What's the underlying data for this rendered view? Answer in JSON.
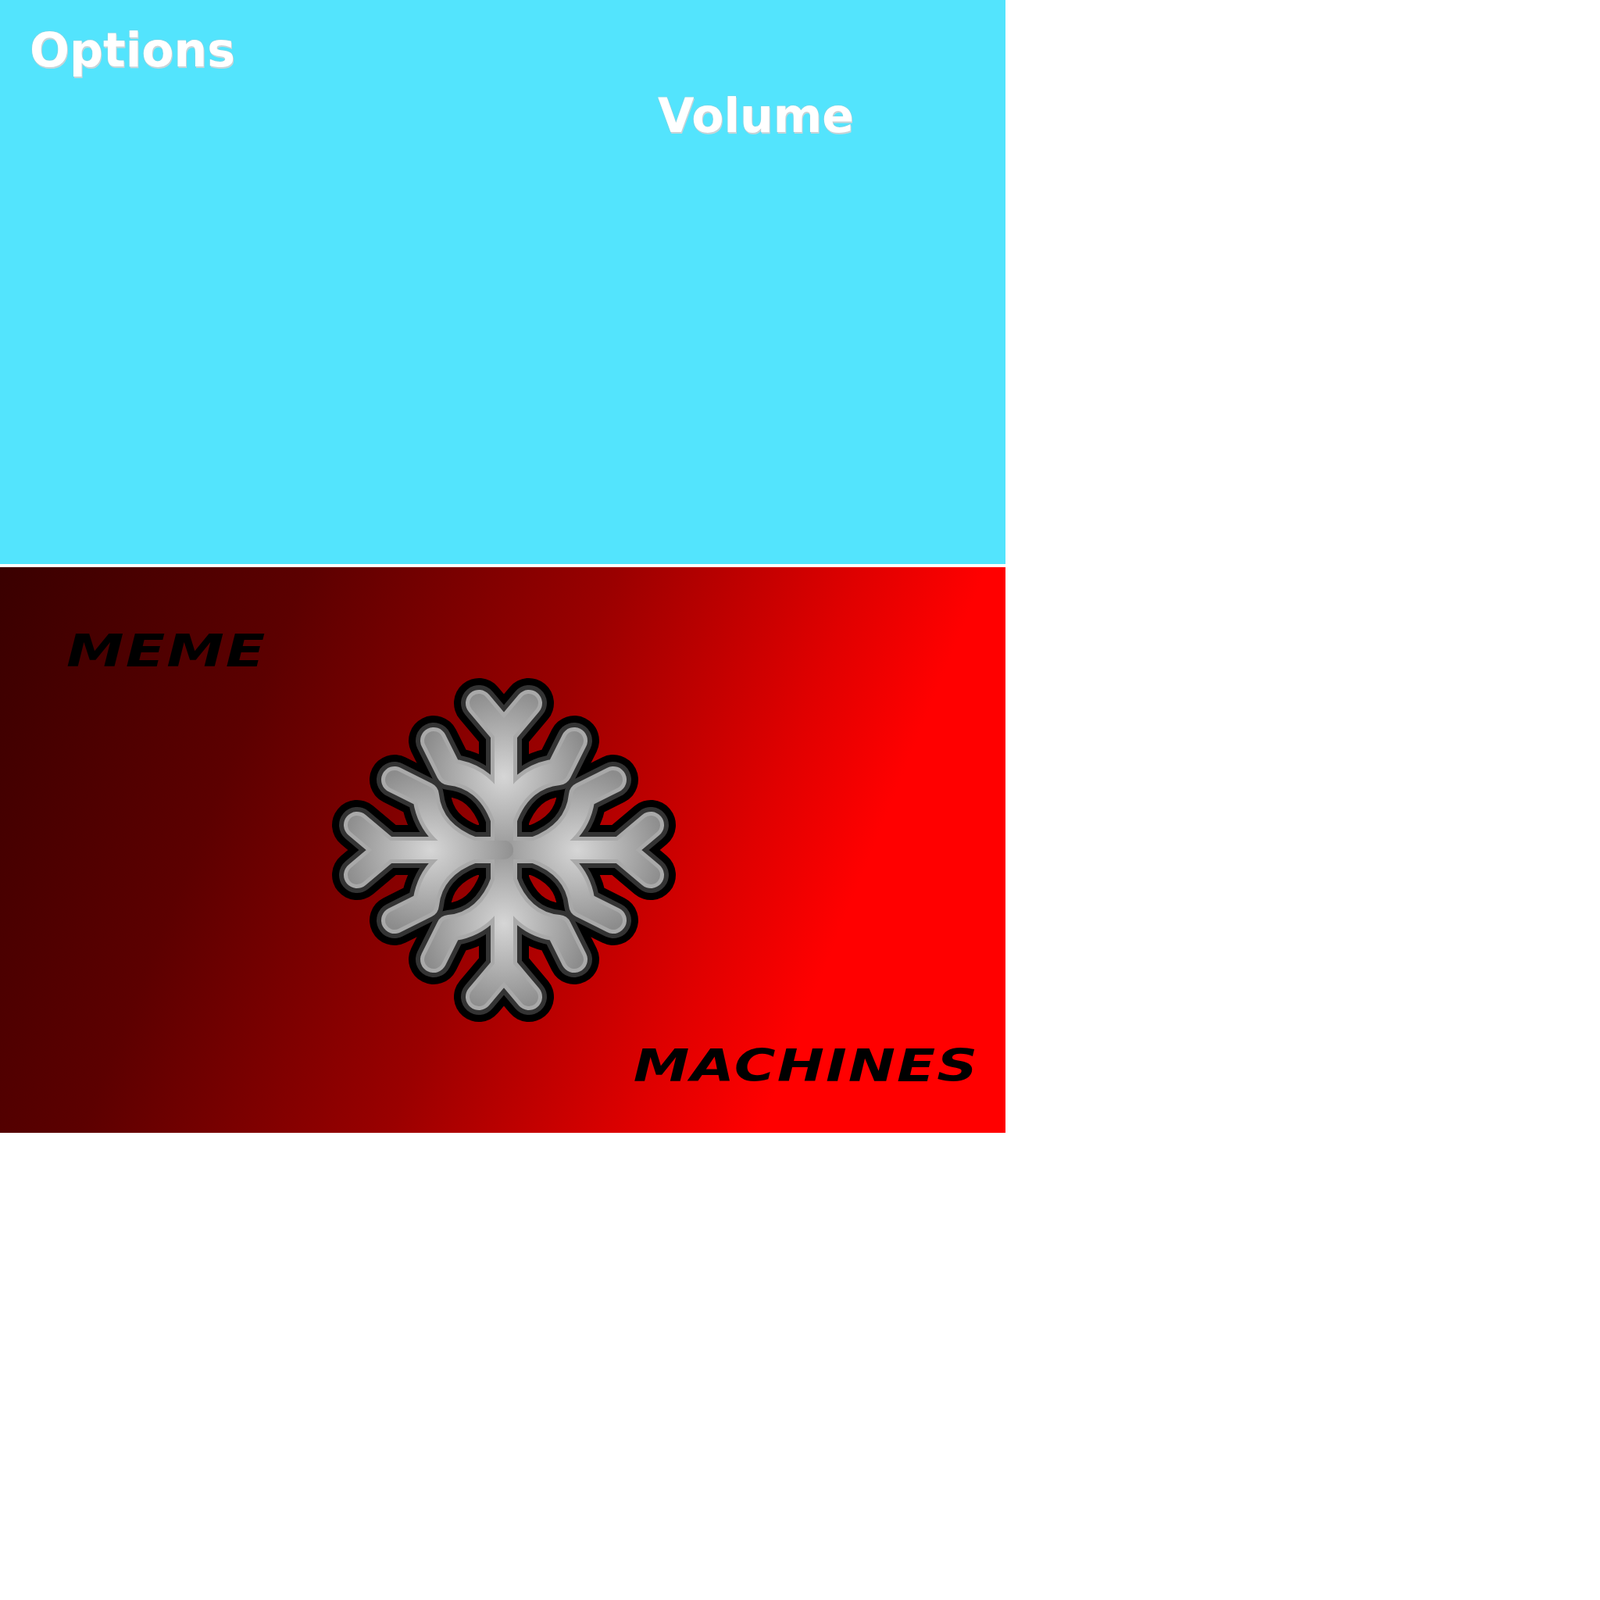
{
  "screen": {
    "title": "Options",
    "labels": [
      "Volume"
    ]
  },
  "logo": {
    "words": [
      "MEME",
      "MACHINES"
    ]
  }
}
